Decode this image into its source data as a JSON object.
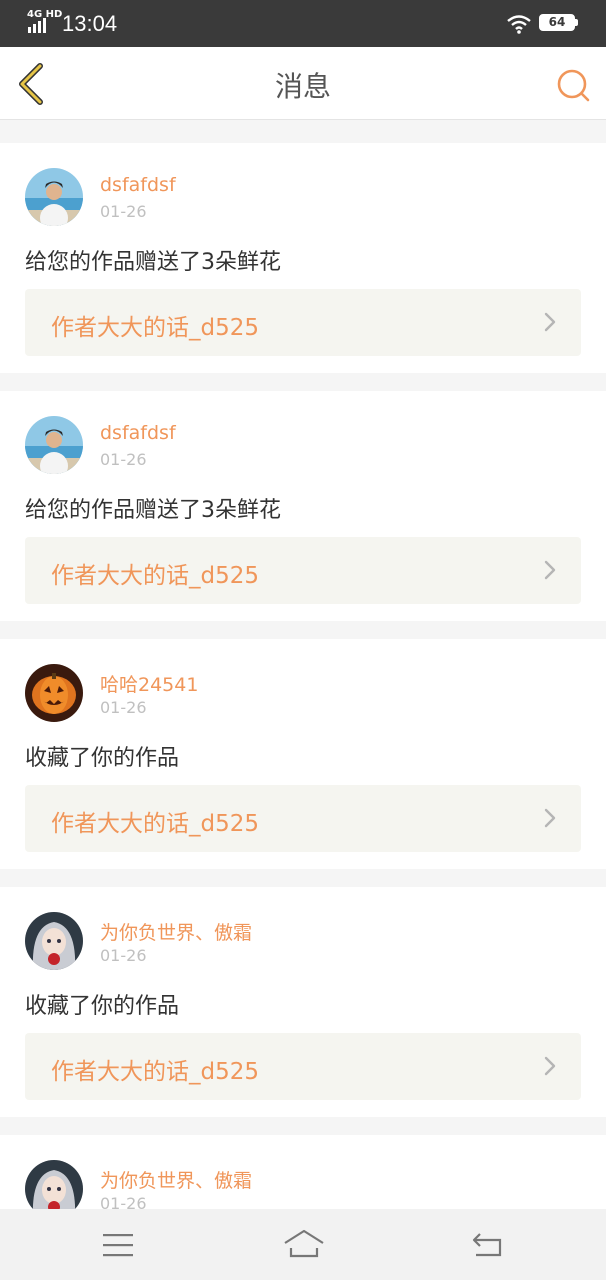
{
  "status_bar": {
    "network": "4G HD",
    "time": "13:04",
    "battery": "64",
    "icons": [
      "signal-icon",
      "wifi-icon",
      "battery-icon"
    ]
  },
  "header": {
    "title": "消息",
    "back_icon": "chevron-left-icon",
    "search_icon": "search-icon"
  },
  "messages": [
    {
      "user": "dsfafdsf",
      "date": "01-26",
      "text": "给您的作品赠送了3朵鲜花",
      "work": "作者大大的话_d525",
      "avatar": "photo-man"
    },
    {
      "user": "dsfafdsf",
      "date": "01-26",
      "text": "给您的作品赠送了3朵鲜花",
      "work": "作者大大的话_d525",
      "avatar": "photo-man"
    },
    {
      "user": "哈哈24541",
      "date": "01-26",
      "text": "收藏了你的作品",
      "work": "作者大大的话_d525",
      "avatar": "pumpkin"
    },
    {
      "user": "为你负世界、傲霜",
      "date": "01-26",
      "text": "收藏了你的作品",
      "work": "作者大大的话_d525",
      "avatar": "anime-girl"
    },
    {
      "user": "为你负世界、傲霜",
      "date": "01-26",
      "text": "",
      "work": "",
      "avatar": "anime-girl"
    }
  ],
  "bottom_nav": {
    "icons": [
      "menu-icon",
      "home-icon",
      "back-icon"
    ]
  },
  "colors": {
    "accent": "#f0965a",
    "back_arrow": "#e6c547",
    "status_bar": "#3a3a3a",
    "work_box": "#f5f5f0"
  }
}
